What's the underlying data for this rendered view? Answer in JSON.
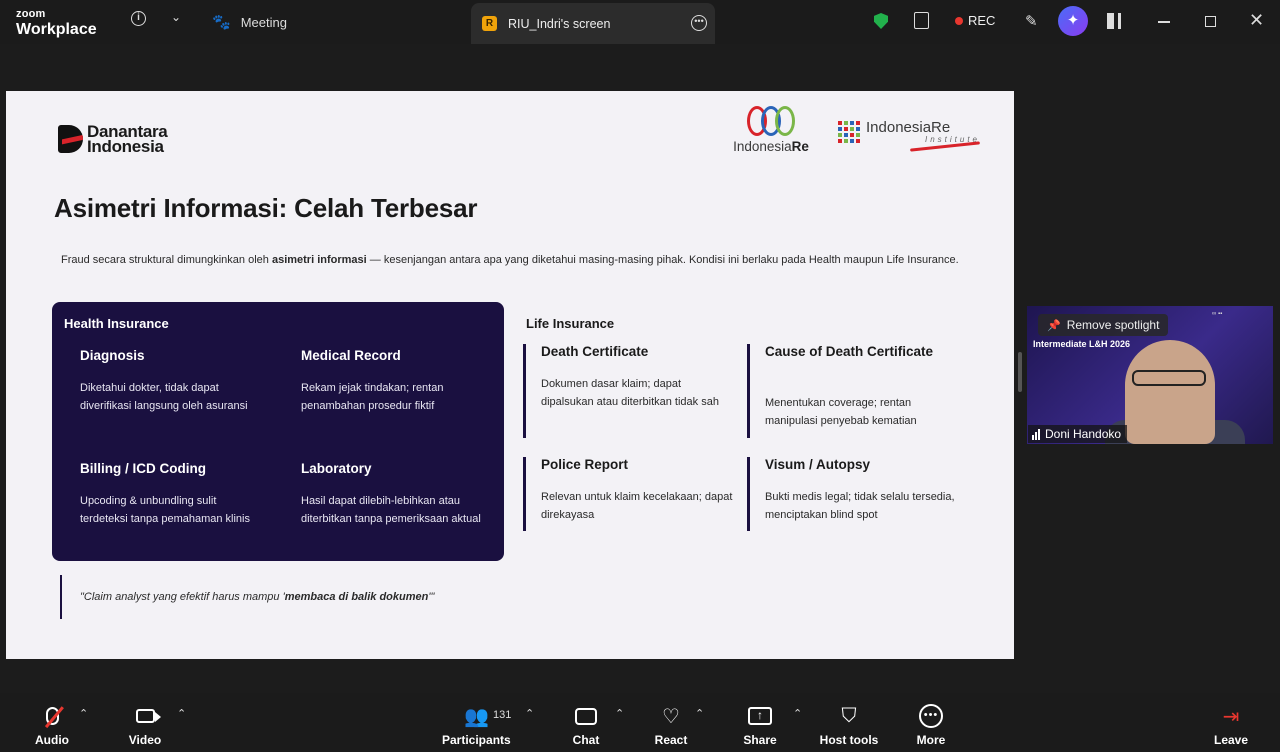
{
  "app": {
    "brand_small": "zoom",
    "brand_large": "Workplace"
  },
  "tabs": {
    "meeting": "Meeting",
    "screen": "RIU_Indri's screen",
    "screen_avatar": "R"
  },
  "status": {
    "rec": "REC"
  },
  "slide": {
    "title": "Asimetri Informasi: Celah Terbesar",
    "intro_before": "Fraud secara struktural dimungkinkan oleh ",
    "intro_bold": "asimetri informasi",
    "intro_after": " — kesenjangan antara apa yang diketahui masing-masing pihak. Kondisi ini berlaku pada Health maupun Life Insurance.",
    "logo_danantara": "Danantara",
    "logo_indonesia": "Indonesia",
    "logo_ire_prefix": "Indonesia",
    "logo_ire_suffix": "Re",
    "logo_inst_main": "IndonesiaRe",
    "logo_inst_sub": "Institute",
    "health": {
      "title": "Health Insurance",
      "items": [
        {
          "title": "Diagnosis",
          "desc1": "Diketahui dokter, tidak dapat",
          "desc2": "diverifikasi langsung oleh asuransi"
        },
        {
          "title": "Medical Record",
          "desc1": "Rekam jejak tindakan; rentan",
          "desc2": "penambahan prosedur fiktif"
        },
        {
          "title": "Billing / ICD Coding",
          "desc1": "Upcoding & unbundling sulit",
          "desc2": "terdeteksi tanpa pemahaman klinis"
        },
        {
          "title": "Laboratory",
          "desc1": "Hasil dapat dilebih-lebihkan atau",
          "desc2": "diterbitkan tanpa pemeriksaan aktual"
        }
      ]
    },
    "life": {
      "title": "Life Insurance",
      "items": [
        {
          "title": "Death Certificate",
          "desc1": "Dokumen dasar klaim; dapat",
          "desc2": "dipalsukan atau diterbitkan tidak sah"
        },
        {
          "title": "Cause of Death Certificate",
          "desc1": "Menentukan coverage; rentan",
          "desc2": "manipulasi penyebab kematian"
        },
        {
          "title": "Police Report",
          "desc1": "Relevan untuk klaim kecelakaan; dapat",
          "desc2": "direkayasa"
        },
        {
          "title": "Visum / Autopsy",
          "desc1": "Bukti medis legal; tidak selalu tersedia,",
          "desc2": "menciptakan blind spot"
        }
      ]
    },
    "quote_before": "\"Claim analyst yang efektif harus mampu '",
    "quote_bold": "membaca di balik dokumen",
    "quote_after": "'\""
  },
  "video": {
    "spotlight": "Remove spotlight",
    "name": "Doni Handoko",
    "header": "Intermediate L&H 2026"
  },
  "toolbar": {
    "audio": "Audio",
    "video": "Video",
    "participants": "Participants",
    "participants_count": "131",
    "chat": "Chat",
    "react": "React",
    "share": "Share",
    "host_tools": "Host tools",
    "more": "More",
    "leave": "Leave"
  },
  "colors": {
    "accent": "#1a1040",
    "rec": "#e8372f",
    "leave": "#e8372f",
    "secure": "#22b14c"
  }
}
